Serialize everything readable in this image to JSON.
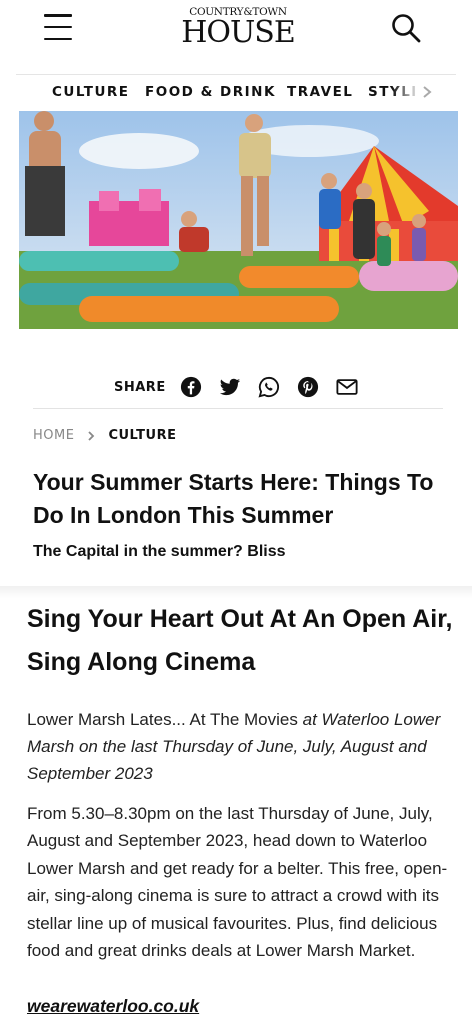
{
  "header": {
    "logo_top": "COUNTRY&TOWN",
    "logo_main": "HOUSE",
    "menu_icon": "hamburger-menu-icon",
    "search_icon": "search-icon"
  },
  "nav": {
    "items": [
      "CULTURE",
      "FOOD & DRINK",
      "TRAVEL",
      "STYLI"
    ],
    "more_icon": "chevron-right-icon"
  },
  "share": {
    "label": "SHARE",
    "icons": [
      "facebook-icon",
      "twitter-icon",
      "whatsapp-icon",
      "pinterest-icon",
      "email-icon"
    ]
  },
  "breadcrumb": {
    "home": "HOME",
    "current": "CULTURE"
  },
  "article": {
    "title": "Your Summer Starts Here: Things To Do In London This Summer",
    "subtitle": "The Capital in the summer? Bliss"
  },
  "section": {
    "heading": "Sing Your Heart Out At An Open Air, Sing Along Cinema",
    "event_name": "Lower Marsh Lates... At The Movies",
    "event_details": "at Waterloo Lower Marsh on the last Thursday of June, July, August and September 2023",
    "body": "From 5.30–8.30pm on the last Thursday of June, July, August and September 2023, head down to Waterloo Lower Marsh and get ready for a belter. This free, open-air, sing-along cinema is sure to attract a crowd with its stellar line up of musical favourites. Plus, find delicious food and great drinks deals at Lower Marsh Market.",
    "link": "wearewaterloo.co.uk"
  },
  "colors": {
    "text": "#111111",
    "muted": "#888888",
    "divider": "#e5e5e5"
  }
}
